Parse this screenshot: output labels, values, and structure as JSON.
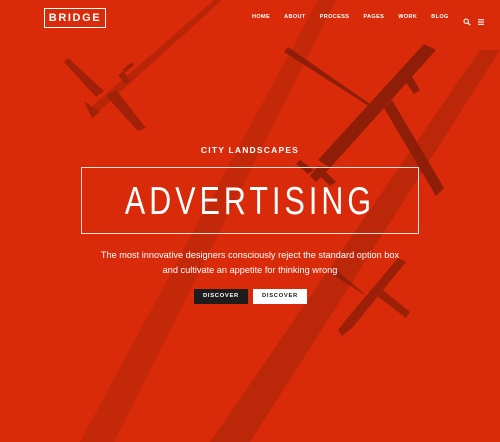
{
  "colors": {
    "background": "#d92b0a",
    "plane_shadow": "#8e1e08",
    "text": "#ffffff",
    "dark_button": "#1d1d1d"
  },
  "header": {
    "logo": "BRIDGE",
    "nav": [
      {
        "label": "HOME"
      },
      {
        "label": "ABOUT"
      },
      {
        "label": "PROCESS"
      },
      {
        "label": "PAGES"
      },
      {
        "label": "WORK"
      },
      {
        "label": "BLOG"
      }
    ],
    "icons": [
      "search-icon",
      "menu-icon"
    ]
  },
  "hero": {
    "subtitle": "CITY LANDSCAPES",
    "title": "ADVERTISING",
    "description_line1": "The most innovative designers consciously reject the standard option box",
    "description_line2": "and cultivate an appetite for thinking wrong",
    "buttons": [
      {
        "label": "DISCOVER"
      },
      {
        "label": "DISCOVER"
      }
    ]
  }
}
